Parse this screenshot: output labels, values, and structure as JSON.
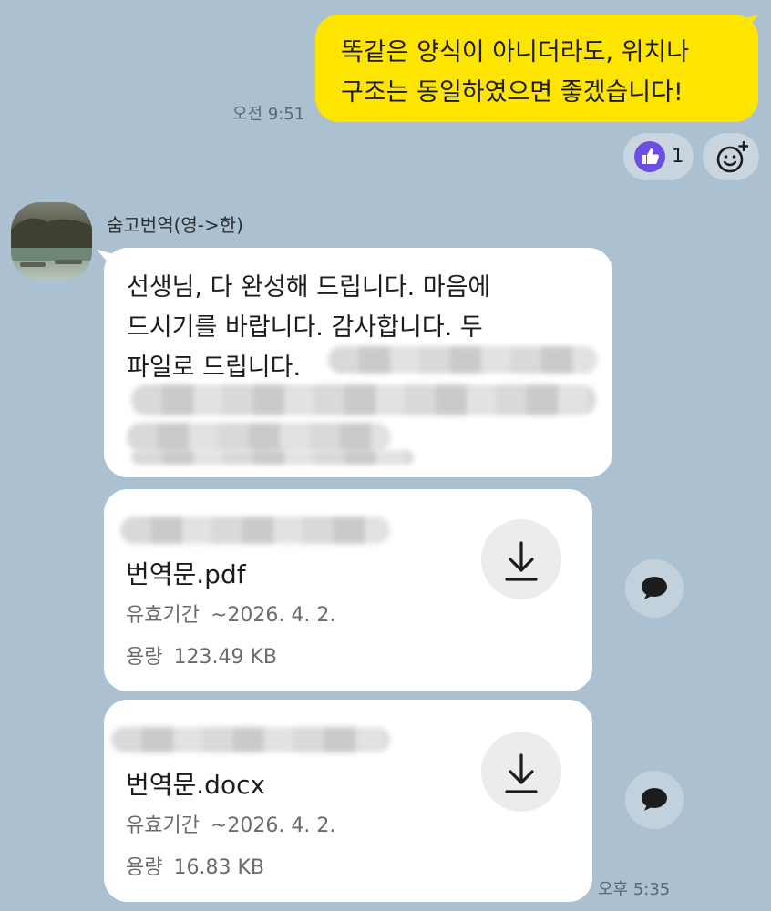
{
  "outgoing": {
    "line1": "똑같은 양식이 아니더라도, 위치나",
    "line2": "구조는 동일하였으면 좋겠습니다!",
    "time": "오전 9:51"
  },
  "reaction": {
    "icon": "thumbs-up-icon",
    "count": "1",
    "add_icon": "add-emoji-icon",
    "accent_color": "#6b4fe2"
  },
  "sender": {
    "name": "숨고번역(영->한)"
  },
  "incoming_message": {
    "line1": "선생님, 다 완성해 드립니다. 마음에",
    "line2": "드시기를 바랍니다. 감사합니다. 두",
    "line3": "파일로 드립니다."
  },
  "files": [
    {
      "name": "번역문.pdf",
      "expiry_label": "유효기간",
      "expiry_value": "~2026. 4. 2.",
      "size_label": "용량",
      "size_value": "123.49 KB",
      "download_icon": "download-icon"
    },
    {
      "name": "번역문.docx",
      "expiry_label": "유효기간",
      "expiry_value": "~2026. 4. 2.",
      "size_label": "용량",
      "size_value": "16.83 KB",
      "download_icon": "download-icon"
    }
  ],
  "incoming_time": "오후 5:35",
  "colors": {
    "background": "#abc1d1",
    "outgoing_bubble": "#fee500",
    "incoming_bubble": "#ffffff"
  }
}
